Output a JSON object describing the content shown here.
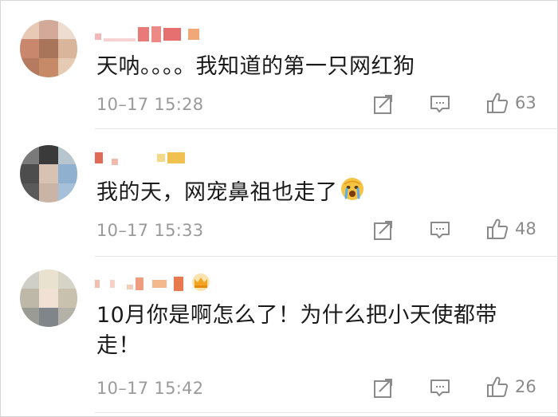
{
  "comments": [
    {
      "text": "天呐。。。。我知道的第一只网红狗",
      "time": "10–17 15:28",
      "likes": "63",
      "avatar_icon": "blurred-avatar-icon",
      "name_colors": [
        "#f2c6c6",
        "#e87a7a",
        "#f0a878",
        "#e9b84a"
      ]
    },
    {
      "text": "我的天，网宠鼻祖也走了",
      "time": "10–17 15:33",
      "likes": "48",
      "avatar_icon": "blurred-avatar-icon",
      "emoji": "crying-face-emoji",
      "name_colors": [
        "#e06a55",
        "#f5d98a",
        "#f1c14f"
      ]
    },
    {
      "text": "10月你是啊怎么了！为什么把小天使都带走！",
      "time": "10–17 15:42",
      "likes": "26",
      "avatar_icon": "blurred-avatar-icon",
      "badge": "crown-badge-icon",
      "name_colors": [
        "#f3c0b0",
        "#ee9e7e",
        "#f4b88e",
        "#e8794e"
      ]
    }
  ],
  "icons": {
    "repost": "repost-icon",
    "comment": "comment-icon",
    "like": "thumbs-up-icon"
  },
  "colors": {
    "text": "#1a1a1a",
    "meta": "#9a9a9a",
    "icon": "#8a8a8a"
  }
}
